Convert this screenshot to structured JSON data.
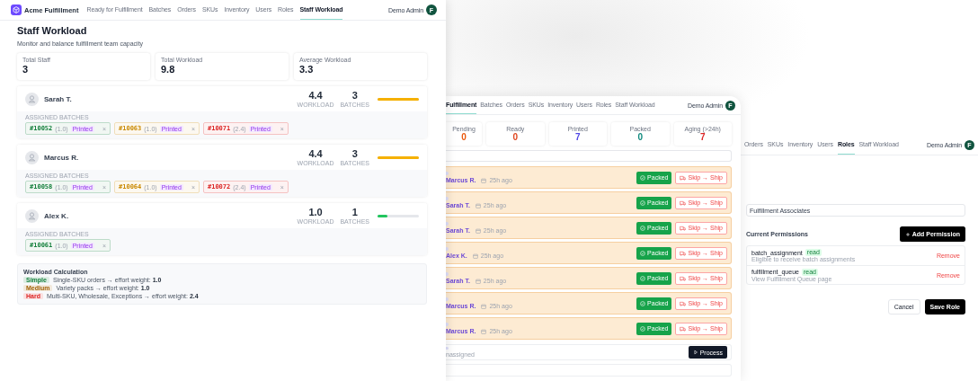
{
  "main_window": {
    "brand": "Acme Fulfillment",
    "nav": [
      {
        "label": "Ready for Fulfillment",
        "selected": false
      },
      {
        "label": "Batches",
        "selected": false
      },
      {
        "label": "Orders",
        "selected": false
      },
      {
        "label": "SKUs",
        "selected": false
      },
      {
        "label": "Inventory",
        "selected": false
      },
      {
        "label": "Users",
        "selected": false
      },
      {
        "label": "Roles",
        "selected": false
      },
      {
        "label": "Staff Workload",
        "selected": true
      }
    ],
    "user": {
      "name": "Demo Admin",
      "initial": "F"
    },
    "title": "Staff Workload",
    "subtitle": "Monitor and balance fulfillment team capacity",
    "stats": [
      {
        "label": "Total Staff",
        "value": "3"
      },
      {
        "label": "Total Workload",
        "value": "9.8"
      },
      {
        "label": "Average Workload",
        "value": "3.3"
      }
    ],
    "staff": [
      {
        "name": "Sarah T.",
        "workload": "4.4",
        "workload_label": "WORKLOAD",
        "batches": "3",
        "batches_label": "BATCHES",
        "level": 1,
        "assigned_label": "ASSIGNED BATCHES",
        "assigned": [
          {
            "id": "#10052",
            "weight": "(1.0)",
            "status": "Printed",
            "remove": "×",
            "color": "#15803d"
          },
          {
            "id": "#10063",
            "weight": "(1.0)",
            "status": "Printed",
            "remove": "×",
            "color": "#ca8a04"
          },
          {
            "id": "#10071",
            "weight": "(2.4)",
            "status": "Printed",
            "remove": "×",
            "color": "#dc2626"
          }
        ]
      },
      {
        "name": "Marcus R.",
        "workload": "4.4",
        "workload_label": "WORKLOAD",
        "batches": "3",
        "batches_label": "BATCHES",
        "level": 1,
        "assigned_label": "ASSIGNED BATCHES",
        "assigned": [
          {
            "id": "#10058",
            "weight": "(1.0)",
            "status": "Printed",
            "remove": "×",
            "color": "#15803d"
          },
          {
            "id": "#10064",
            "weight": "(1.0)",
            "status": "Printed",
            "remove": "×",
            "color": "#ca8a04"
          },
          {
            "id": "#10072",
            "weight": "(2.4)",
            "status": "Printed",
            "remove": "×",
            "color": "#dc2626"
          }
        ]
      },
      {
        "name": "Alex K.",
        "workload": "1.0",
        "workload_label": "WORKLOAD",
        "batches": "1",
        "batches_label": "BATCHES",
        "level": 0.23,
        "assigned_label": "ASSIGNED BATCHES",
        "assigned": [
          {
            "id": "#10061",
            "weight": "(1.0)",
            "status": "Printed",
            "remove": "×",
            "color": "#15803d"
          }
        ]
      }
    ],
    "legend": {
      "title": "Workload Calculation",
      "items": [
        {
          "color": "#15803d",
          "badge": "Simple",
          "text": "Single-SKU orders → effort weight: **1.0**"
        },
        {
          "color": "#a16207",
          "badge": "Medium",
          "text": "Variety packs → effort weight: **1.0**"
        },
        {
          "color": "#dc2626",
          "badge": "Hard",
          "text": "Multi-SKU, Wholesale, Exceptions → effort weight: **2.4**"
        }
      ]
    }
  },
  "queue_window": {
    "nav": [
      {
        "label": "Fulfillment",
        "selected": true
      },
      {
        "label": "Batches",
        "selected": false
      },
      {
        "label": "Orders",
        "selected": false
      },
      {
        "label": "SKUs",
        "selected": false
      },
      {
        "label": "Inventory",
        "selected": false
      },
      {
        "label": "Users",
        "selected": false
      },
      {
        "label": "Roles",
        "selected": false
      },
      {
        "label": "Staff Workload",
        "selected": false
      }
    ],
    "user": {
      "name": "Demo Admin",
      "initial": "F"
    },
    "stats": [
      {
        "label": "Pending",
        "value": "0",
        "color": "#ea580c"
      },
      {
        "label": "Ready",
        "value": "0",
        "color": "#e0461f"
      },
      {
        "label": "Printed",
        "value": "7",
        "color": "#4f46e5"
      },
      {
        "label": "Packed",
        "value": "0",
        "color": "#0f8a7e"
      },
      {
        "label": "Aging (>24h)",
        "value": "7",
        "color": "#dc2626"
      }
    ],
    "rows": [
      {
        "assignee": "Marcus R.",
        "age": "25h ago",
        "packed": "Packed",
        "skip": "Skip → Ship"
      },
      {
        "assignee": "Sarah T.",
        "age": "25h ago",
        "packed": "Packed",
        "skip": "Skip → Ship"
      },
      {
        "assignee": "Sarah T.",
        "age": "25h ago",
        "packed": "Packed",
        "skip": "Skip → Ship"
      },
      {
        "assignee": "Alex K.",
        "age": "25h ago",
        "packed": "Packed",
        "skip": "Skip → Ship"
      },
      {
        "assignee": "Sarah T.",
        "age": "25h ago",
        "packed": "Packed",
        "skip": "Skip → Ship"
      },
      {
        "assignee": "Marcus R.",
        "age": "25h ago",
        "packed": "Packed",
        "skip": "Skip → Ship"
      },
      {
        "assignee": "Marcus R.",
        "age": "25h ago",
        "packed": "Packed",
        "skip": "Skip → Ship"
      }
    ],
    "unassigned_row": {
      "text": "nassigned",
      "button": "Process"
    }
  },
  "roles_window": {
    "nav": [
      {
        "label": "Orders",
        "selected": false
      },
      {
        "label": "SKUs",
        "selected": false
      },
      {
        "label": "Inventory",
        "selected": false
      },
      {
        "label": "Users",
        "selected": false
      },
      {
        "label": "Roles",
        "selected": true
      },
      {
        "label": "Staff Workload",
        "selected": false
      }
    ],
    "user": {
      "name": "Demo Admin",
      "initial": "F"
    },
    "role_name": "Fulfillment Associates",
    "permissions_title": "Current Permissions",
    "add_button": "Add Permission",
    "permissions": [
      {
        "name": "batch_assignment",
        "access": "read",
        "description": "Eligible to receive batch assignments",
        "action": "Remove"
      },
      {
        "name": "fulfillment_queue",
        "access": "read",
        "description": "View Fulfillment Queue page",
        "action": "Remove"
      }
    ],
    "buttons": [
      {
        "label": "Cancel",
        "kind": "secondary"
      },
      {
        "label": "Save Role",
        "kind": "primary"
      }
    ]
  }
}
